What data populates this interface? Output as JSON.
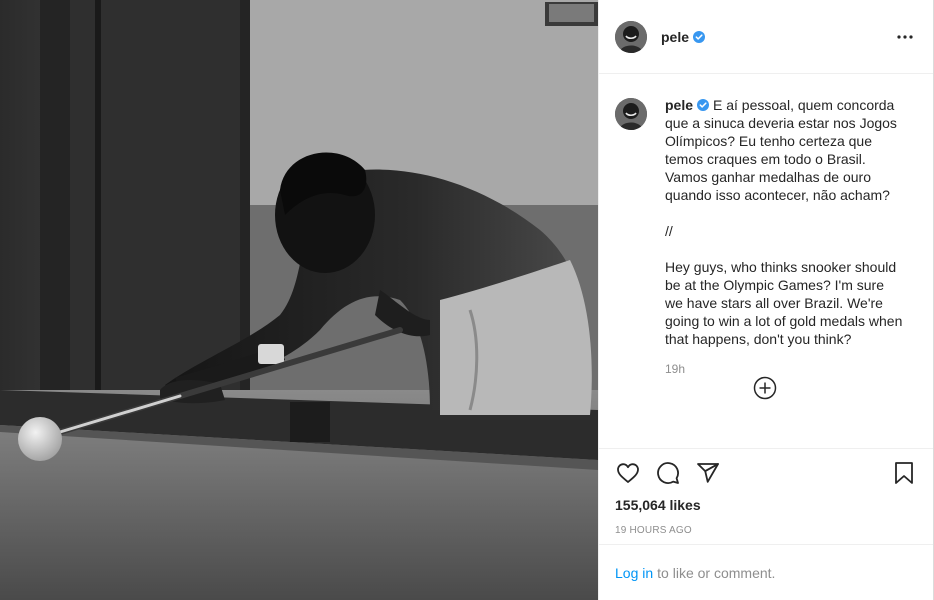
{
  "post": {
    "username": "pele",
    "image_alt": "Black and white photo of a man leaning over a billiard table aiming a cue at a white ball"
  },
  "caption": {
    "username": "pele",
    "text": "E aí pessoal, quem concorda que a sinuca deveria estar nos Jogos Olímpicos? Eu tenho certeza que temos craques em todo o Brasil. Vamos ganhar medalhas de ouro quando isso acontecer, não acham?\n\n//\n\nHey guys, who thinks snooker should be at the Olympic Games? I'm sure we have stars all over Brazil. We're going to win a lot of gold medals when that happens, don't you think?",
    "time": "19h"
  },
  "actions": {
    "likes": "155,064 likes",
    "timestamp": "19 HOURS AGO"
  },
  "login": {
    "link": "Log in",
    "text": "to like or comment."
  },
  "icons": {
    "more": "more-options-icon",
    "verified": "verified-badge-icon",
    "load_more": "plus-circle-icon",
    "like": "heart-icon",
    "comment": "comment-icon",
    "share": "paper-plane-icon",
    "save": "bookmark-icon"
  },
  "colors": {
    "verified": "#3897f0",
    "link": "#0095f6",
    "text": "#262626",
    "secondary": "#8e8e8e"
  }
}
